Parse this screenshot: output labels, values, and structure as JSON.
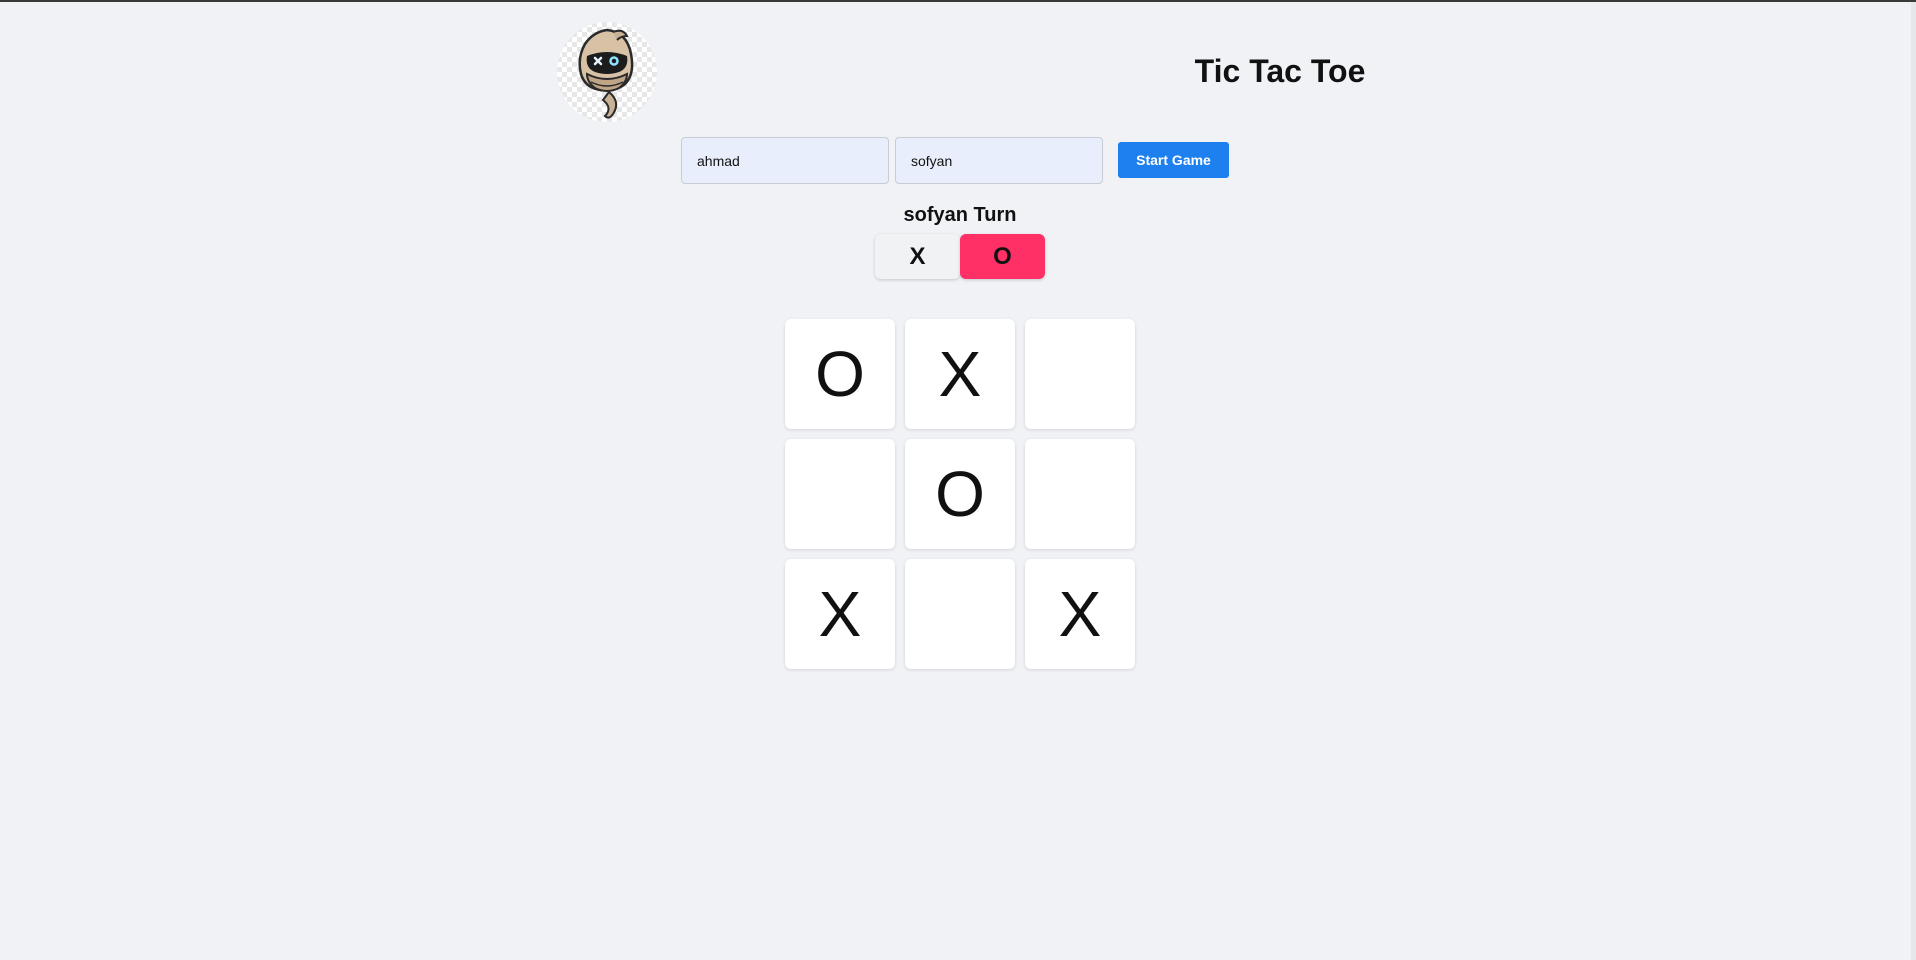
{
  "app": {
    "title": "Tic Tac Toe",
    "logo_icon": "hooded-ninja-avatar-icon"
  },
  "players": {
    "player1": {
      "value": "ahmad"
    },
    "player2": {
      "value": "sofyan"
    }
  },
  "start_button": {
    "label": "Start Game",
    "color": "#1d80ee"
  },
  "turn": {
    "text": "sofyan Turn"
  },
  "symbol_buttons": {
    "x": {
      "label": "X",
      "selected": false,
      "color": "#f1f2f4"
    },
    "o": {
      "label": "O",
      "selected": true,
      "color": "#fe3065"
    }
  },
  "board": {
    "cells": [
      "O",
      "X",
      "",
      "",
      "O",
      "",
      "X",
      "",
      "X"
    ]
  }
}
